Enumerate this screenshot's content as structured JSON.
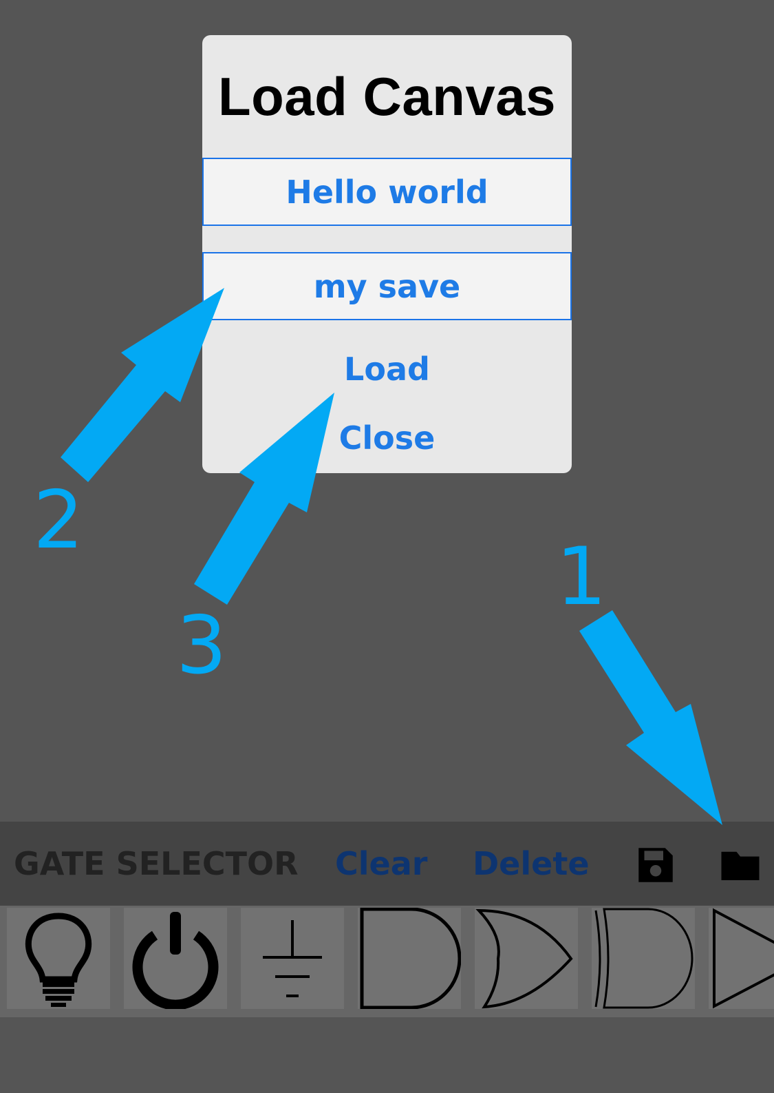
{
  "dialog": {
    "title": "Load Canvas",
    "saves": [
      "Hello world",
      "my save"
    ],
    "load_label": "Load",
    "close_label": "Close"
  },
  "annotations": {
    "step1": "1",
    "step2": "2",
    "step3": "3",
    "color": "#03a9f4"
  },
  "toolbar": {
    "title": "GATE SELECTOR",
    "clear_label": "Clear",
    "delete_label": "Delete",
    "save_icon": "floppy-disk-icon",
    "load_icon": "folder-icon"
  },
  "palette": {
    "gates": [
      "light-bulb-icon",
      "power-icon",
      "ground-icon",
      "and-gate-icon",
      "or-gate-icon",
      "xor-gate-icon",
      "buffer-gate-icon"
    ]
  },
  "colors": {
    "background": "#555555",
    "dialog_bg": "#e8e8e8",
    "accent": "#1e7be6",
    "toolbar_bg": "#444444",
    "toolbar_button": "#0d3470",
    "palette_bg": "#666666"
  }
}
